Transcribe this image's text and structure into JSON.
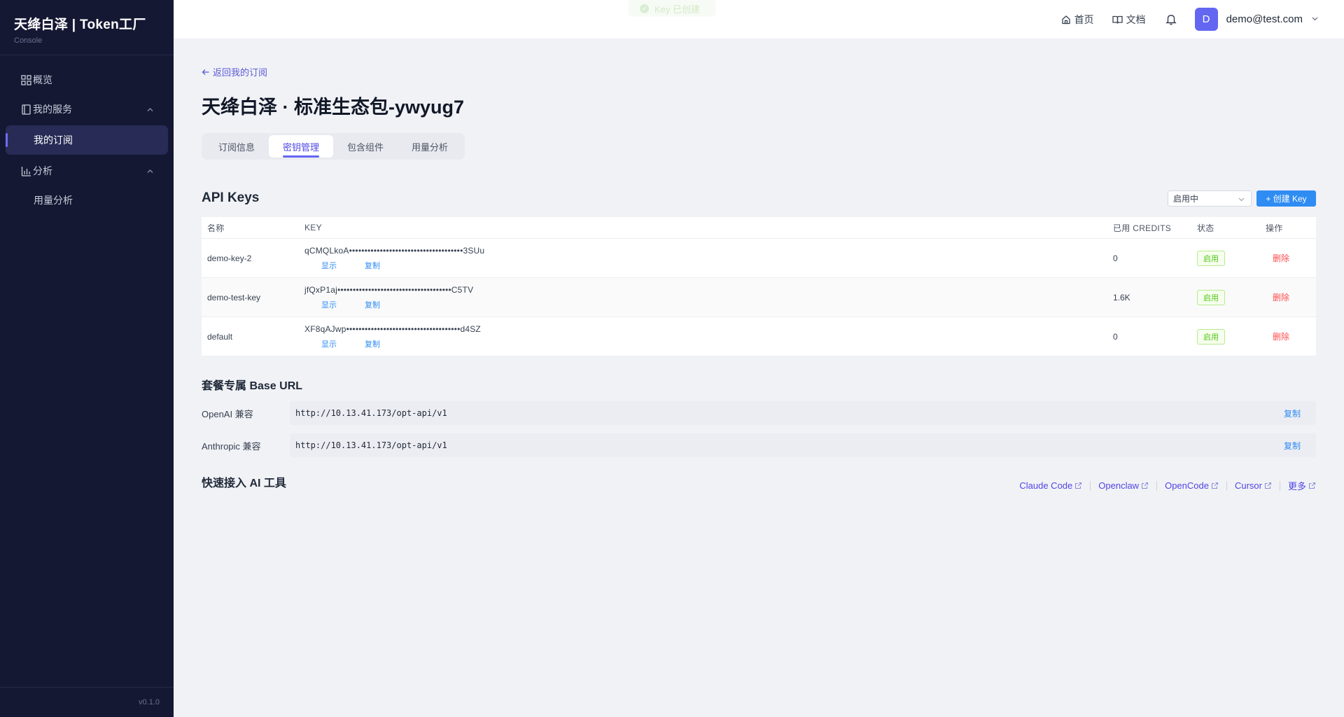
{
  "sidebar": {
    "brand_title": "天绛白泽 | Token工厂",
    "brand_sub": "Console",
    "items": [
      {
        "label": "概览",
        "icon": "grid-icon"
      },
      {
        "label": "我的服务",
        "icon": "book-icon"
      },
      {
        "label": "我的订阅"
      },
      {
        "label": "分析",
        "icon": "bar-chart-icon"
      },
      {
        "label": "用量分析"
      }
    ],
    "version": "v0.1.0"
  },
  "header": {
    "home": "首页",
    "docs": "文档",
    "avatar_letter": "D",
    "email": "demo@test.com"
  },
  "toast": {
    "text": "Key 已创建"
  },
  "page": {
    "back": "返回我的订阅",
    "title": "天绛白泽 · 标准生态包-ywyug7",
    "tabs": [
      "订阅信息",
      "密钥管理",
      "包含组件",
      "用量分析"
    ],
    "active_tab": "密钥管理"
  },
  "api_keys": {
    "title": "API Keys",
    "filter": "启用中",
    "create": "+ 创建 Key",
    "columns": [
      "名称",
      "KEY",
      "已用 CREDITS",
      "状态",
      "操作"
    ],
    "rows": [
      {
        "name": "demo-key-2",
        "key": "qCMQLkoA•••••••••••••••••••••••••••••••••••••3SUu",
        "show": "显示",
        "copy": "复制",
        "credits": "0",
        "status": "启用",
        "action": "删除"
      },
      {
        "name": "demo-test-key",
        "key": "jfQxP1aj•••••••••••••••••••••••••••••••••••••C5TV",
        "show": "显示",
        "copy": "复制",
        "credits": "1.6K",
        "status": "启用",
        "action": "删除"
      },
      {
        "name": "default",
        "key": "XF8qAJwp•••••••••••••••••••••••••••••••••••••d4SZ",
        "show": "显示",
        "copy": "复制",
        "credits": "0",
        "status": "启用",
        "action": "删除"
      }
    ]
  },
  "base_url": {
    "title": "套餐专属 Base URL",
    "rows": [
      {
        "label": "OpenAI 兼容",
        "url": "http://10.13.41.173/opt-api/v1",
        "copy": "复制"
      },
      {
        "label": "Anthropic 兼容",
        "url": "http://10.13.41.173/opt-api/v1",
        "copy": "复制"
      }
    ]
  },
  "quick_tools": {
    "title": "快速接入 AI 工具",
    "links": [
      "Claude Code",
      "Openclaw",
      "OpenCode",
      "Cursor",
      "更多"
    ]
  },
  "colors": {
    "sidebar_bg": "#151833",
    "accent": "#6366f1",
    "primary_button": "#2f8cf3",
    "danger": "#ff4d4f",
    "success": "#52c41a"
  }
}
